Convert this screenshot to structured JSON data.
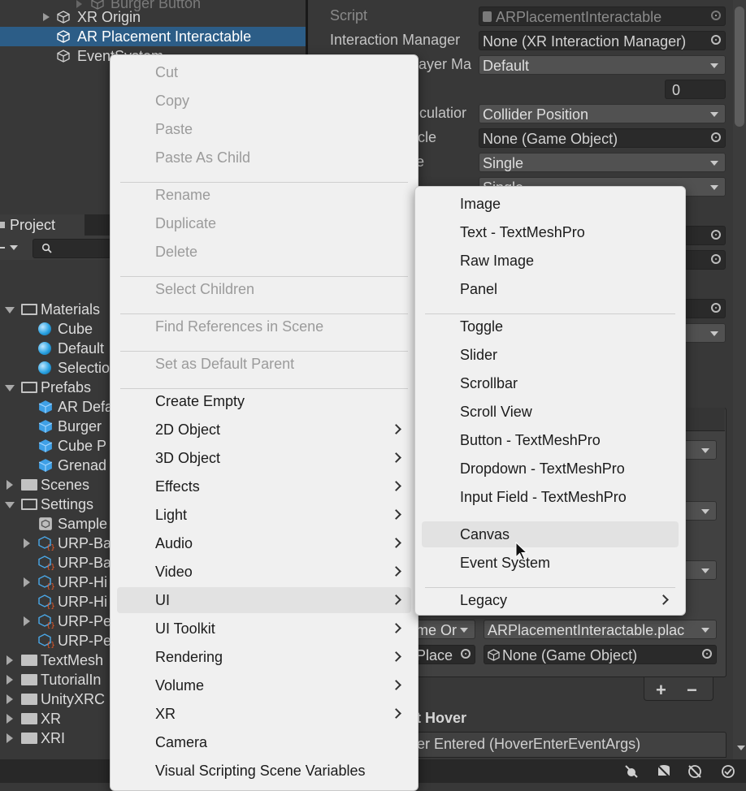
{
  "hierarchy": {
    "items": [
      {
        "label": "Burger Button",
        "muted": true
      },
      {
        "label": "XR Origin",
        "muted": false
      },
      {
        "label": "AR Placement Interactable",
        "muted": false,
        "selected": true
      },
      {
        "label": "EventSystem",
        "muted": false
      }
    ]
  },
  "project": {
    "tab_label": "Project",
    "tree": [
      {
        "label": "Materials",
        "kind": "folder",
        "expanded": true,
        "depth": 0
      },
      {
        "label": "Cube",
        "kind": "material",
        "depth": 1
      },
      {
        "label": "Default",
        "kind": "material",
        "depth": 1
      },
      {
        "label": "Selection",
        "kind": "material",
        "depth": 1
      },
      {
        "label": "Prefabs",
        "kind": "folder",
        "expanded": true,
        "depth": 0
      },
      {
        "label": "AR Defa",
        "kind": "prefab",
        "depth": 1
      },
      {
        "label": "Burger",
        "kind": "prefab",
        "depth": 1
      },
      {
        "label": "Cube P",
        "kind": "prefab",
        "depth": 1
      },
      {
        "label": "Grenad",
        "kind": "prefab",
        "depth": 1
      },
      {
        "label": "Scenes",
        "kind": "folder",
        "expanded": false,
        "depth": 0
      },
      {
        "label": "Settings",
        "kind": "folder",
        "expanded": true,
        "depth": 0
      },
      {
        "label": "Sample",
        "kind": "asset",
        "depth": 1
      },
      {
        "label": "URP-Ba",
        "kind": "urp",
        "depth": 1
      },
      {
        "label": "URP-Ba",
        "kind": "urp",
        "depth": 1
      },
      {
        "label": "URP-Hi",
        "kind": "urp",
        "depth": 1
      },
      {
        "label": "URP-Hi",
        "kind": "urp",
        "depth": 1
      },
      {
        "label": "URP-Pe",
        "kind": "urp",
        "depth": 1
      },
      {
        "label": "URP-Pe",
        "kind": "urp",
        "depth": 1
      },
      {
        "label": "TextMesh",
        "kind": "folder",
        "expanded": false,
        "depth": 0
      },
      {
        "label": "TutorialIn",
        "kind": "folder",
        "expanded": false,
        "depth": 0
      },
      {
        "label": "UnityXRC",
        "kind": "folder",
        "expanded": false,
        "depth": 0
      },
      {
        "label": "XR",
        "kind": "folder",
        "expanded": false,
        "depth": 0
      },
      {
        "label": "XRI",
        "kind": "folder",
        "expanded": false,
        "depth": 0
      }
    ]
  },
  "inspector": {
    "script_label": "Script",
    "script_value": "ARPlacementInteractable",
    "interaction_manager_label": "Interaction Manager",
    "interaction_manager_value": "None (XR Interaction Manager)",
    "layer_label": "ayer Ma",
    "layer_value": "Default",
    "number_value": "0",
    "calc_label": "lculatior",
    "calc_value": "Collider Position",
    "cle_label": "cle",
    "cle_value": "None (Game Object)",
    "e_label": "e",
    "select_mode_value": "Single",
    "select_mode2_value": "Single",
    "event_dropdown": "me Or",
    "event_function": "ARPlacementInteractable.plac",
    "event_object": "Place",
    "event_target": "None (Game Object)",
    "hover_header": "t Hover",
    "hover_event": "er Entered (HoverEnterEventArgs)"
  },
  "context_menu": {
    "items": [
      {
        "label": "Cut",
        "disabled": true
      },
      {
        "label": "Copy",
        "disabled": true
      },
      {
        "label": "Paste",
        "disabled": true
      },
      {
        "label": "Paste As Child",
        "disabled": true
      },
      {
        "sep": true
      },
      {
        "label": "Rename",
        "disabled": true
      },
      {
        "label": "Duplicate",
        "disabled": true
      },
      {
        "label": "Delete",
        "disabled": true
      },
      {
        "sep": true
      },
      {
        "label": "Select Children",
        "disabled": true
      },
      {
        "sep": true
      },
      {
        "label": "Find References in Scene",
        "disabled": true
      },
      {
        "sep": true
      },
      {
        "label": "Set as Default Parent",
        "disabled": true
      },
      {
        "sep": true
      },
      {
        "label": "Create Empty"
      },
      {
        "label": "2D Object",
        "submenu": true
      },
      {
        "label": "3D Object",
        "submenu": true
      },
      {
        "label": "Effects",
        "submenu": true
      },
      {
        "label": "Light",
        "submenu": true
      },
      {
        "label": "Audio",
        "submenu": true
      },
      {
        "label": "Video",
        "submenu": true
      },
      {
        "label": "UI",
        "submenu": true,
        "highlighted": true
      },
      {
        "label": "UI Toolkit",
        "submenu": true
      },
      {
        "label": "Rendering",
        "submenu": true
      },
      {
        "label": "Volume",
        "submenu": true
      },
      {
        "label": "XR",
        "submenu": true
      },
      {
        "label": "Camera"
      },
      {
        "label": "Visual Scripting Scene Variables"
      }
    ]
  },
  "ui_submenu": {
    "items": [
      {
        "label": "Image"
      },
      {
        "label": "Text - TextMeshPro"
      },
      {
        "label": "Raw Image"
      },
      {
        "label": "Panel"
      },
      {
        "sep": true
      },
      {
        "label": "Toggle"
      },
      {
        "label": "Slider"
      },
      {
        "label": "Scrollbar"
      },
      {
        "label": "Scroll View"
      },
      {
        "label": "Button - TextMeshPro"
      },
      {
        "label": "Dropdown - TextMeshPro"
      },
      {
        "label": "Input Field - TextMeshPro"
      },
      {
        "sep": true
      },
      {
        "label": "Canvas",
        "highlighted": true
      },
      {
        "label": "Event System"
      },
      {
        "sep": true
      },
      {
        "label": "Legacy",
        "submenu": true
      }
    ]
  },
  "colors": {
    "selection": "#2c5d87",
    "menu_bg": "#f0f0f0",
    "editor_bg": "#383838"
  }
}
